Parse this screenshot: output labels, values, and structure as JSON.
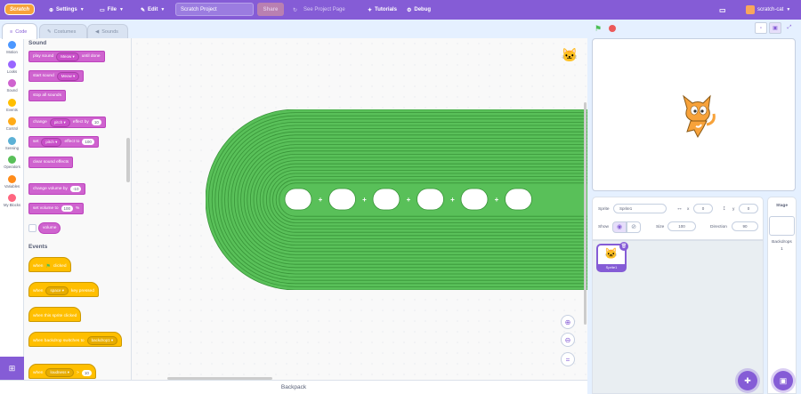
{
  "menu": {
    "logo": "Scratch",
    "settings": "Settings",
    "file": "File",
    "edit": "Edit",
    "project_title": "Scratch Project",
    "share": "Share",
    "see_project_page": "See Project Page",
    "tutorials": "Tutorials",
    "debug": "Debug",
    "username": "scratch-cat"
  },
  "tabs": {
    "code": "Code",
    "costumes": "Costumes",
    "sounds": "Sounds"
  },
  "categories": [
    {
      "label": "Motion",
      "color": "#4c97ff"
    },
    {
      "label": "Looks",
      "color": "#9966ff"
    },
    {
      "label": "Sound",
      "color": "#cf63cf"
    },
    {
      "label": "Events",
      "color": "#ffbf00"
    },
    {
      "label": "Control",
      "color": "#ffab19"
    },
    {
      "label": "Sensing",
      "color": "#5cb1d6"
    },
    {
      "label": "Operators",
      "color": "#59c059"
    },
    {
      "label": "Variables",
      "color": "#ff8c1a"
    },
    {
      "label": "My Blocks",
      "color": "#ff6680"
    }
  ],
  "palette": {
    "sound_heading": "Sound",
    "play_sound": "play sound",
    "until_done": "until done",
    "meow": "Meow",
    "start_sound": "start sound",
    "stop_all_sounds": "stop all sounds",
    "change": "change",
    "pitch": "pitch",
    "effect_by": "effect by",
    "val_10": "10",
    "set": "set",
    "effect_to": "effect to",
    "val_100": "100",
    "clear_sound_effects": "clear sound effects",
    "change_volume_by": "change volume by",
    "val_neg10": "-10",
    "set_volume_to": "set volume to",
    "percent": "%",
    "volume": "volume",
    "events_heading": "Events",
    "when": "when",
    "clicked": "clicked",
    "space": "space",
    "key_pressed": "key pressed",
    "when_sprite_clicked": "when this sprite clicked",
    "when_backdrop": "when backdrop switches to",
    "backdrop1": "backdrop1",
    "loudness": "loudness",
    "gt": ">"
  },
  "workspace": {
    "plus": "+",
    "slot_count": 6
  },
  "backpack": "Backpack",
  "sprite_info": {
    "sprite_label": "Sprite",
    "sprite_name": "Sprite1",
    "x_label": "x",
    "x_value": "0",
    "y_label": "y",
    "y_value": "0",
    "show_label": "Show",
    "size_label": "Size",
    "size_value": "100",
    "direction_label": "Direction",
    "direction_value": "90"
  },
  "sprite_list": [
    {
      "name": "Sprite1",
      "selected": true
    }
  ],
  "stage_panel": {
    "title": "Stage",
    "backdrops_label": "Backdrops",
    "backdrops_count": "1"
  },
  "colors": {
    "accent": "#855cd6",
    "sound": "#cf63cf",
    "events": "#ffbf00",
    "operators": "#59c059"
  }
}
